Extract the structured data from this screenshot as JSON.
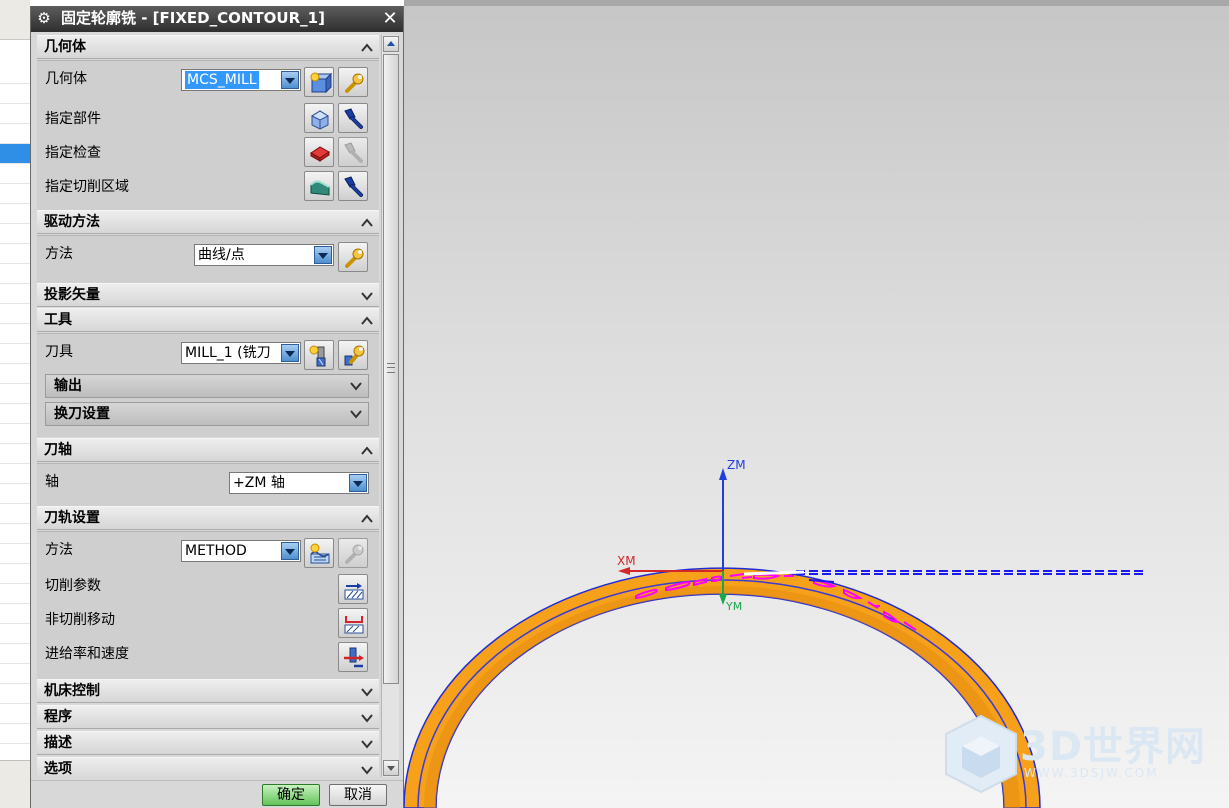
{
  "dialog": {
    "title": "固定轮廓铣 - [FIXED_CONTOUR_1]",
    "ok_label": "确定",
    "cancel_label": "取消"
  },
  "sections": {
    "geometry": {
      "header": "几何体",
      "geometry_label": "几何体",
      "geometry_value": "MCS_MILL",
      "specify_part": "指定部件",
      "specify_check": "指定检查",
      "specify_cut_area": "指定切削区域"
    },
    "drive_method": {
      "header": "驱动方法",
      "method_label": "方法",
      "method_value": "曲线/点"
    },
    "projection_vector": {
      "header": "投影矢量"
    },
    "tool": {
      "header": "工具",
      "tool_label": "刀具",
      "tool_value": "MILL_1 (铣刀",
      "output": "输出",
      "tool_change": "换刀设置"
    },
    "tool_axis": {
      "header": "刀轴",
      "axis_label": "轴",
      "axis_value": "+ZM 轴"
    },
    "path_settings": {
      "header": "刀轨设置",
      "method_label": "方法",
      "method_value": "METHOD",
      "cutting_params": "切削参数",
      "non_cutting": "非切削移动",
      "feeds_speeds": "进给率和速度"
    },
    "machine_control": {
      "header": "机床控制"
    },
    "program": {
      "header": "程序"
    },
    "description": {
      "header": "描述"
    },
    "options": {
      "header": "选项"
    }
  },
  "viewport": {
    "axis_zm": "ZM",
    "axis_xm": "XM",
    "axis_ym": "YM",
    "colors": {
      "part": "#f7a11a",
      "toolpath": "#ff00ff",
      "approach": "#1a1aee",
      "z_axis": "#1f3fd6",
      "x_axis": "#d4252a",
      "y_axis": "#1aa84a"
    },
    "watermark": {
      "text": "3D世界网",
      "url": "WWW.3DSJW.COM"
    }
  },
  "icons": [
    "gear-icon",
    "close-icon",
    "chevron-up-icon",
    "chevron-down-icon",
    "geometry-new-icon",
    "wrench-edit-icon",
    "part-icon",
    "flashlight-icon",
    "check-body-icon",
    "cut-area-icon",
    "tool-new-icon",
    "method-new-icon",
    "cut-params-icon",
    "non-cutting-icon",
    "feeds-speeds-icon"
  ]
}
